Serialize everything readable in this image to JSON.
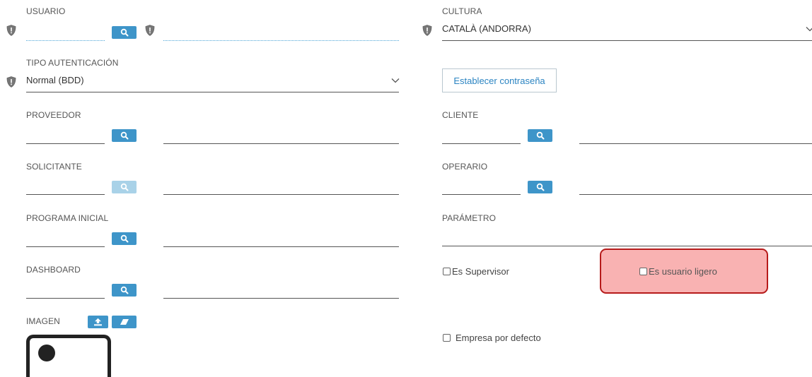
{
  "left": {
    "usuario": {
      "label": "USUARIO",
      "value": "",
      "desc": ""
    },
    "tipo_autenticacion": {
      "label": "TIPO AUTENTICACIÓN",
      "value": "Normal (BDD)"
    },
    "proveedor": {
      "label": "PROVEEDOR",
      "code": "",
      "desc": ""
    },
    "solicitante": {
      "label": "SOLICITANTE",
      "code": "",
      "desc": ""
    },
    "programa_inicial": {
      "label": "PROGRAMA INICIAL",
      "code": "",
      "desc": ""
    },
    "dashboard": {
      "label": "DASHBOARD",
      "code": "",
      "desc": ""
    },
    "imagen": {
      "label": "IMAGEN"
    }
  },
  "right": {
    "cultura": {
      "label": "CULTURA",
      "value": "CATALÀ (ANDORRA)"
    },
    "establecer_contrasena": "Establecer contraseña",
    "cliente": {
      "label": "CLIENTE",
      "code": "",
      "desc": ""
    },
    "operario": {
      "label": "OPERARIO",
      "code": "",
      "desc": ""
    },
    "parametro": {
      "label": "PARÁMETRO",
      "value": ""
    },
    "es_supervisor": {
      "label": "Es Supervisor",
      "checked": false
    },
    "es_usuario_ligero": {
      "label": "Es usuario ligero",
      "checked": false
    },
    "empresa_por_defecto": {
      "label": "Empresa por defecto",
      "checked": false
    }
  },
  "icons": {
    "search": "search-icon",
    "shield": "shield-icon",
    "chevron": "chevron-down-icon",
    "upload": "upload-icon",
    "eraser": "eraser-icon",
    "avatar": "avatar-icon"
  },
  "colors": {
    "accent": "#3e95c9",
    "accent_disabled": "#a9d2e8",
    "link": "#2b84c2",
    "highlight_fill": "#f9b2b2",
    "highlight_border": "#b61b1b"
  }
}
